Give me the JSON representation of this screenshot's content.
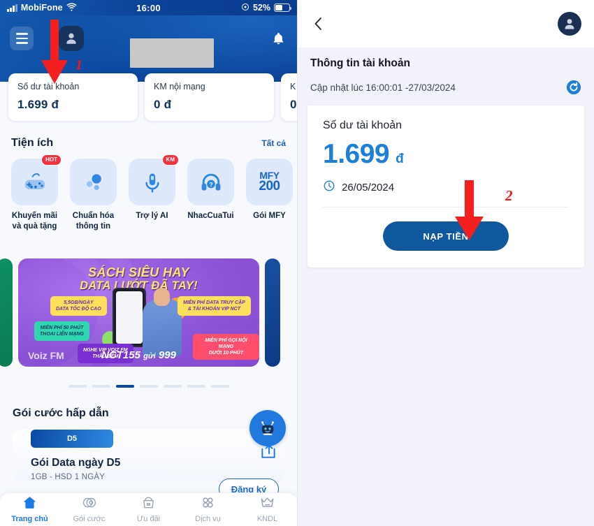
{
  "left": {
    "statusbar": {
      "carrier": "MobiFone",
      "time": "16:00",
      "battery_percent": "52%",
      "signal_icon": "signal-bars-icon",
      "wifi_icon": "wifi-icon",
      "battery_icon": "battery-icon",
      "location_icon": "location-services-icon"
    },
    "header": {
      "menu_icon": "hamburger-menu-icon",
      "avatar_icon": "user-avatar-icon",
      "bell_icon": "notification-bell-icon",
      "user_name_redacted": ""
    },
    "balance_cards": [
      {
        "label": "Số dư tài khoản",
        "value": "1.699 đ"
      },
      {
        "label": "KM nội mạng",
        "value": "0 đ"
      },
      {
        "label": "K",
        "value": "0"
      }
    ],
    "utilities": {
      "title": "Tiện ích",
      "see_all": "Tất cả",
      "items": [
        {
          "label": "Khuyến mãi\nvà quà tặng",
          "label_l1": "Khuyến mãi",
          "label_l2": "và quà tặng",
          "badge": "HOT",
          "icon": "gamepad-icon"
        },
        {
          "label_l1": "Chuẩn hóa",
          "label_l2": "thông tin",
          "badge": "",
          "icon": "dots-bubble-icon"
        },
        {
          "label_l1": "Trợ lý AI",
          "label_l2": "",
          "badge": "KM",
          "icon": "microphone-icon"
        },
        {
          "label_l1": "NhacCuaTui",
          "label_l2": "",
          "badge": "",
          "icon": "headphones-question-icon"
        },
        {
          "label_l1": "Gói MFY",
          "label_l2": "",
          "badge": "",
          "icon": "mfy-200-icon",
          "tile_t1": "MFY",
          "tile_t2": "200"
        }
      ]
    },
    "banner": {
      "title_line1": "SÁCH SIÊU HAY",
      "title_line2": "DATA LƯỚT ĐÃ TAY!",
      "pills": [
        "5,5GB/NGÀY\nDATA TỐC ĐỘ CAO",
        "MIỄN PHÍ 50 PHÚT\nTHOAI LIÊN MẠNG",
        "NGHE VIP VOIZ FM\nTHÂU ĐÊM",
        "MIỄN PHÍ DATA TRUY CẬP\n& TÀI KHOẢN VIP NCT",
        "MIỄN PHÍ GỌI NỘI MẠNG\nDƯỚI 10 PHÚT"
      ],
      "pill1_l1": "5,5GB/NGÀY",
      "pill1_l2": "DATA TỐC ĐỘ CAO",
      "pill2_l1": "MIỄN PHÍ 50 PHÚT",
      "pill2_l2": "THOAI LIÊN MẠNG",
      "pill3_l1": "NGHE VIP VOIZ FM",
      "pill3_l2": "THÂU ĐÊM",
      "pill4_l1": "MIỄN PHÍ DATA TRUY CẬP",
      "pill4_l2": "& TÀI KHOẢN VIP NCT",
      "pill5_l1": "MIỄN PHÍ GỌI NỘI MẠNG",
      "pill5_l2": "DƯỚI 10 PHÚT",
      "brand": "Voiz FM",
      "cta_code": "NCT155",
      "cta_send": "gửi",
      "cta_number": "999",
      "dots_total": 7,
      "dots_active_index": 2
    },
    "packages": {
      "title": "Gói cước hấp dẫn",
      "card": {
        "tag": "D5",
        "name": "Gói Data ngày D5",
        "desc": "1GB - HSD 1 NGÀY",
        "register_label": "Đăng ký"
      },
      "chatbot_icon": "chatbot-robot-icon",
      "share_icon": "share-icon"
    },
    "tabbar": [
      {
        "label": "Trang chủ",
        "icon": "home-icon",
        "active": true
      },
      {
        "label": "Gói cước",
        "icon": "package-icon",
        "active": false
      },
      {
        "label": "Ưu đãi",
        "icon": "gift-basket-icon",
        "active": false
      },
      {
        "label": "Dịch vụ",
        "icon": "grid-dots-icon",
        "active": false
      },
      {
        "label": "KNDL",
        "icon": "crown-icon",
        "active": false
      }
    ],
    "annotation": {
      "number": "1",
      "arrow_icon": "down-arrow-annotation"
    }
  },
  "right": {
    "topbar": {
      "back_icon": "back-chevron-icon",
      "avatar_icon": "user-avatar-icon"
    },
    "page_title": "Thông tin tài khoản",
    "updated_text": "Cập nhật lúc 16:00:01 -27/03/2024",
    "refresh_icon": "refresh-icon",
    "balance": {
      "label": "Số dư tài khoản",
      "amount": "1.699",
      "currency": "đ",
      "expiry_date": "26/05/2024",
      "clock_icon": "clock-icon",
      "topup_label": "NẠP TIỀN"
    },
    "annotation": {
      "number": "2",
      "arrow_icon": "down-arrow-annotation"
    }
  },
  "colors": {
    "header_blue": "#0c4aa0",
    "accent_blue": "#1d7fd6",
    "button_blue": "#10589e",
    "annotation_red": "#ef1b1b",
    "right_bg": "#f2f2fa"
  }
}
